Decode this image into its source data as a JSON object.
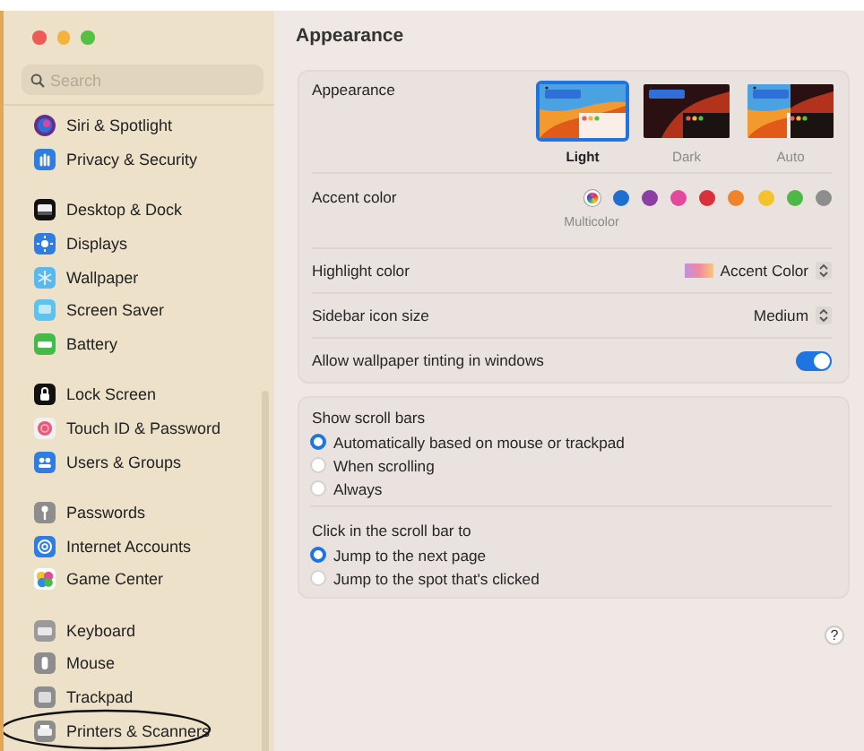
{
  "sidebar": {
    "search": {
      "placeholder": "Search"
    },
    "groups": [
      {
        "items": [
          {
            "label": "Siri & Spotlight",
            "circled": false
          },
          {
            "label": "Privacy & Security",
            "circled": false
          }
        ]
      },
      {
        "items": [
          {
            "label": "Desktop & Dock",
            "circled": false
          },
          {
            "label": "Displays",
            "circled": false
          },
          {
            "label": "Wallpaper",
            "circled": false
          },
          {
            "label": "Screen Saver",
            "circled": false
          },
          {
            "label": "Battery",
            "circled": false
          }
        ]
      },
      {
        "items": [
          {
            "label": "Lock Screen",
            "circled": false
          },
          {
            "label": "Touch ID & Password",
            "circled": false
          },
          {
            "label": "Users & Groups",
            "circled": false
          }
        ]
      },
      {
        "items": [
          {
            "label": "Passwords",
            "circled": false
          },
          {
            "label": "Internet Accounts",
            "circled": false
          },
          {
            "label": "Game Center",
            "circled": false
          }
        ]
      },
      {
        "items": [
          {
            "label": "Keyboard",
            "circled": false
          },
          {
            "label": "Mouse",
            "circled": false
          },
          {
            "label": "Trackpad",
            "circled": false
          },
          {
            "label": "Printers & Scanners",
            "circled": true
          }
        ]
      }
    ]
  },
  "pane": {
    "title": "Appearance",
    "appearance": {
      "label": "Appearance",
      "options": [
        {
          "kind": "light",
          "label": "Light",
          "selected": true
        },
        {
          "kind": "dark",
          "label": "Dark",
          "selected": false
        },
        {
          "kind": "auto",
          "label": "Auto",
          "selected": false
        }
      ]
    },
    "accent": {
      "label": "Accent color",
      "colors": [
        {
          "kind": "multicolor",
          "label": "Multicolor",
          "selected": true
        },
        {
          "kind": "solid",
          "color": "#1f6fd1",
          "selected": false
        },
        {
          "kind": "solid",
          "color": "#8b3ea3",
          "selected": false
        },
        {
          "kind": "solid",
          "color": "#e24b9b",
          "selected": false
        },
        {
          "kind": "solid",
          "color": "#da303b",
          "selected": false
        },
        {
          "kind": "solid",
          "color": "#ef8429",
          "selected": false
        },
        {
          "kind": "solid",
          "color": "#f6c22b",
          "selected": false
        },
        {
          "kind": "solid",
          "color": "#4db748",
          "selected": false
        },
        {
          "kind": "solid",
          "color": "#8d8d8d",
          "selected": false
        }
      ]
    },
    "highlight": {
      "label": "Highlight color",
      "value": "Accent Color"
    },
    "icon_size": {
      "label": "Sidebar icon size",
      "value": "Medium"
    },
    "tinting": {
      "label": "Allow wallpaper tinting in windows",
      "on": true
    },
    "scroll_bars": {
      "label": "Show scroll bars",
      "options": [
        {
          "label": "Automatically based on mouse or trackpad",
          "selected": true
        },
        {
          "label": "When scrolling",
          "selected": false
        },
        {
          "label": "Always",
          "selected": false
        }
      ]
    },
    "click": {
      "label": "Click in the scroll bar to",
      "options": [
        {
          "label": "Jump to the next page",
          "selected": true
        },
        {
          "label": "Jump to the spot that's clicked",
          "selected": false
        }
      ]
    },
    "help": "?"
  }
}
